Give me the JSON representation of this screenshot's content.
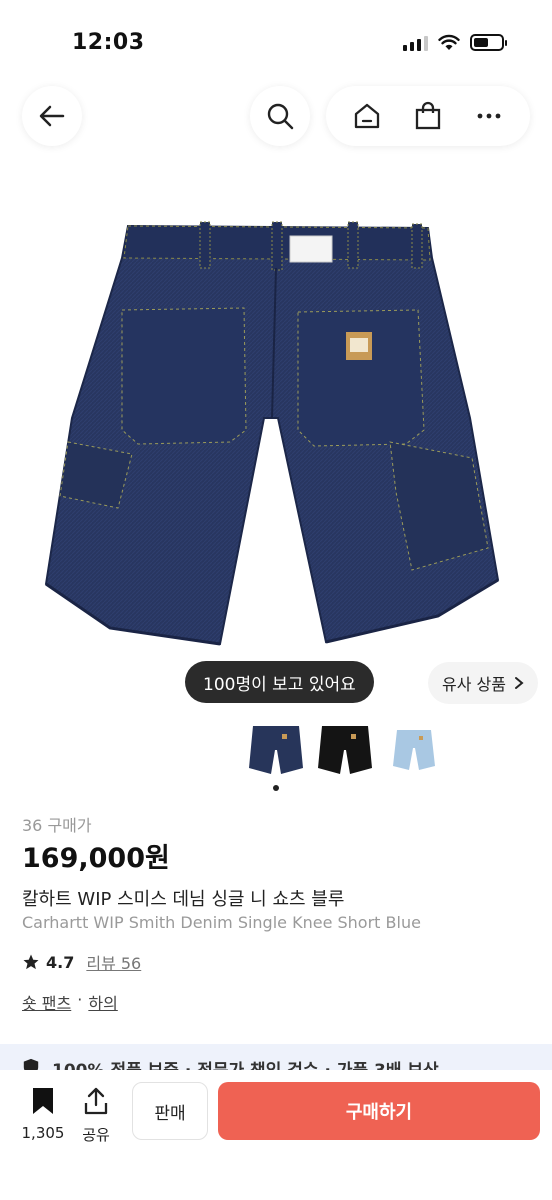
{
  "status_bar": {
    "time": "12:03"
  },
  "product": {
    "viewers_text": "100명이 보고 있어요",
    "similar_label": "유사 상품",
    "buyer_count": "36 구매가",
    "price": "169,000원",
    "title_ko": "칼하트 WIP 스미스 데님 싱글 니 쇼츠 블루",
    "title_en": "Carhartt WIP Smith Denim Single Knee Short Blue",
    "rating": "4.7",
    "review_label": "리뷰 56",
    "category": [
      "숏 팬츠",
      "하의"
    ],
    "category_sep": "·"
  },
  "thumbnails": [
    {
      "color": "#27355a"
    },
    {
      "color": "#141414"
    },
    {
      "color": "#a9c8e3"
    }
  ],
  "banner": {
    "text": "100% 정품 보증 · 전문가 책임 검수 · 가품 3배 보상"
  },
  "bottom_bar": {
    "bookmark_count": "1,305",
    "share_label": "공유",
    "sell_label": "판매",
    "buy_label": "구매하기"
  },
  "colors": {
    "accent": "#ef6253",
    "denim": "#283660"
  }
}
